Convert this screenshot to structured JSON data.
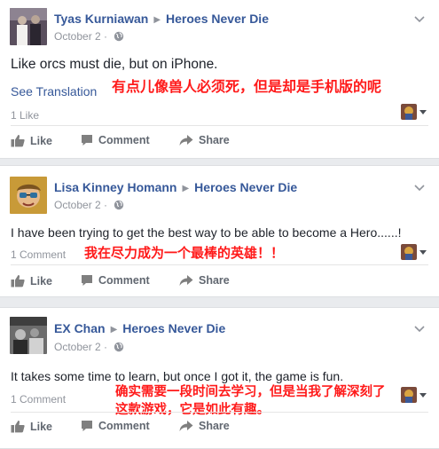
{
  "posts": [
    {
      "author": "Tyas Kurniawan",
      "page": "Heroes Never Die",
      "date": "October 2",
      "date_sep": "·",
      "body": "Like orcs must die, but on iPhone.",
      "see_translation": "See Translation",
      "annotation": "有点儿像兽人必须死，但是却是手机版的呢",
      "count": "1 Like"
    },
    {
      "author": "Lisa Kinney Homann",
      "page": "Heroes Never Die",
      "date": "October 2",
      "date_sep": "·",
      "body": "I have been trying to get the best way to be able to become a Hero......!",
      "annotation": "我在尽力成为一个最棒的英雄！！",
      "count": "1 Comment"
    },
    {
      "author": "EX Chan",
      "page": "Heroes Never Die",
      "date": "October 2",
      "date_sep": "·",
      "body": "It takes some time to learn, but once I got it, the game is fun.",
      "annotation_line1": "确实需要一段时间去学习，但是当我了解深刻了",
      "annotation_line2": "这款游戏，它是如此有趣。",
      "count": "1 Comment"
    }
  ],
  "actions": {
    "like": "Like",
    "comment": "Comment",
    "share": "Share"
  },
  "colors": {
    "link": "#365899",
    "annotation": "#ff1a1a",
    "muted": "#90949c",
    "background": "#e9ebee"
  },
  "icons": [
    "globe-icon",
    "chevron-down-icon",
    "thumbs-up-icon",
    "comment-icon",
    "share-icon",
    "reactor-avatar-icon"
  ]
}
